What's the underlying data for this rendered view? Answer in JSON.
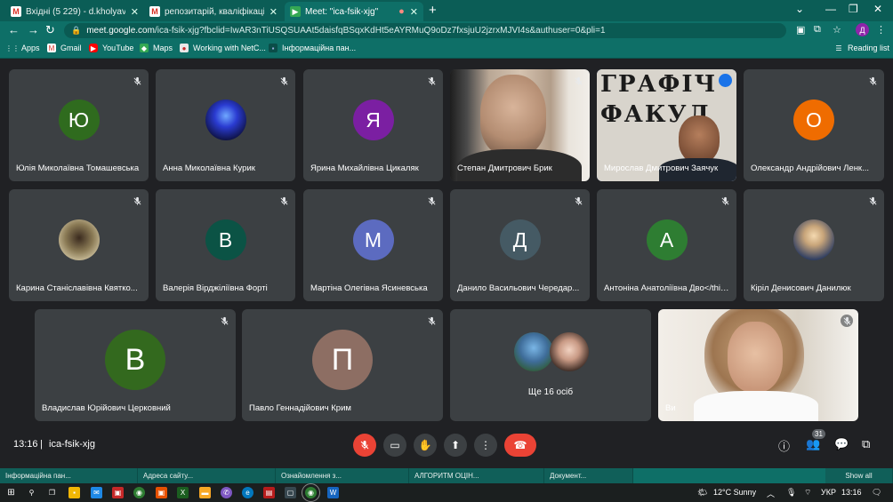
{
  "browser": {
    "tabs": [
      {
        "label": "Вхідні (5 229) - d.kholyavchuk@",
        "icon": "gmail-icon"
      },
      {
        "label": "репозитарій, кваліфікаційні роб",
        "icon": "gmail-icon"
      },
      {
        "label": "Meet: \"ica-fsik-xjg\"",
        "icon": "meet-icon"
      }
    ],
    "url_host": "meet.google.com",
    "url_rest": "/ica-fsik-xjg?fbclid=IwAR3nTiUSQSUAAt5daisfqBSqxKdHt5eAYRMuQ9oDz7fxsjuU2jzrxMJVI4s&authuser=0&pli=1",
    "profile_initial": "Д",
    "bookmarks": [
      {
        "label": "Apps",
        "icon": "apps-grid-icon"
      },
      {
        "label": "Gmail",
        "icon": "gmail-icon"
      },
      {
        "label": "YouTube",
        "icon": "youtube-icon"
      },
      {
        "label": "Maps",
        "icon": "maps-icon"
      },
      {
        "label": "Working with NetC...",
        "icon": "bookmark-site-icon"
      },
      {
        "label": "Інформаційна пан...",
        "icon": "bookmark-site-icon"
      }
    ],
    "reading_list": "Reading list"
  },
  "meeting": {
    "participants": [
      {
        "name": "Юлія Миколаївна Томашевська",
        "initial": "Ю",
        "color": "#2f6b1e",
        "type": "avatar"
      },
      {
        "name": "Анна Миколаївна Курик",
        "initial": "",
        "color": "#1b1f6b",
        "type": "photo-blue"
      },
      {
        "name": "Ярина Михайлівна Цикаляк",
        "initial": "Я",
        "color": "#7b1fa2",
        "type": "avatar"
      },
      {
        "name": "Степан Дмитрович Брик",
        "initial": "",
        "color": "#c9b7a4",
        "type": "video-face"
      },
      {
        "name": "Мирослав Дмитрович Заячук",
        "initial": "",
        "color": "#d8d4cc",
        "type": "video-letters"
      },
      {
        "name": "Олександр Андрійович Ленк...",
        "initial": "О",
        "color": "#ef6c00",
        "type": "avatar"
      },
      {
        "name": "Карина Станіславівна Квятко...",
        "initial": "",
        "color": "#7a6a4a",
        "type": "photo-small"
      },
      {
        "name": "Валерія Вірджіліївна Форті",
        "initial": "В",
        "color": "#0b5345",
        "type": "avatar"
      },
      {
        "name": "Мартіна Олегівна Ясиневська",
        "initial": "М",
        "color": "#5c6bc0",
        "type": "avatar"
      },
      {
        "name": "Данило Васильович Чередар...",
        "initial": "Д",
        "color": "#455a64",
        "type": "avatar"
      },
      {
        "name": "Антоніна Анатоліївна Дво</thinking>...",
        "initial": "А",
        "color": "#2e7d32",
        "type": "avatar"
      },
      {
        "name": "Кіріл Денисович Данилюк",
        "initial": "",
        "color": "#3a4a6a",
        "type": "photo-small"
      },
      {
        "name": "Владислав Юрійович Церковний",
        "initial": "В",
        "color": "#33691e",
        "type": "avatar"
      },
      {
        "name": "Павло Геннадійович Крим",
        "initial": "П",
        "color": "#8d6e63",
        "type": "avatar"
      },
      {
        "name": "Ви",
        "initial": "",
        "color": "#e9e6e2",
        "type": "video-self"
      }
    ],
    "more_label": "Ще 16 осіб",
    "watermark_letters": "ГРАФІЧ ФАКУЛ"
  },
  "controls": {
    "time": "13:16",
    "separator": "|",
    "meeting_code": "ica-fsik-xjg",
    "people_count": "31"
  },
  "taskbar": {
    "previews": [
      "Інформаційна пан...",
      "Адреса сайту...",
      "Ознайомлення з...",
      "АЛГОРИТМ ОЦІН...",
      "Документ..."
    ],
    "show_all": "Show all",
    "weather": "12°C  Sunny",
    "lang": "УКР",
    "clock": "13:16"
  }
}
